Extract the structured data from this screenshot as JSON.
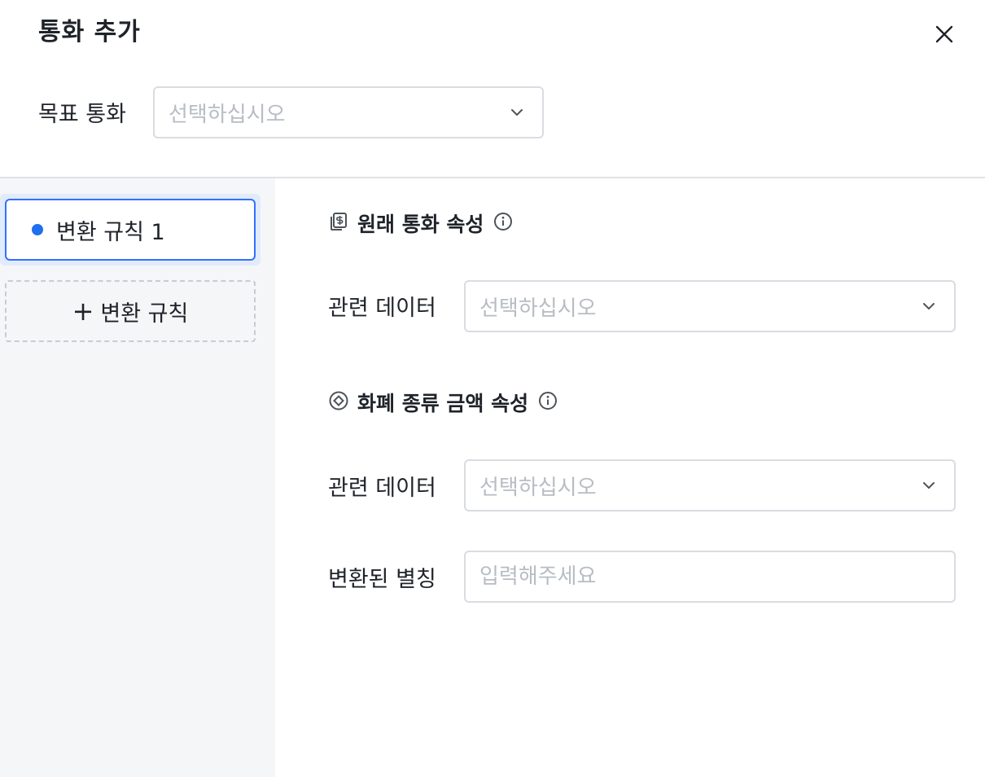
{
  "dialog": {
    "title": "통화 추가",
    "close_icon": "close-icon"
  },
  "target_currency": {
    "label": "목표 통화",
    "placeholder": "선택하십시오"
  },
  "sidebar": {
    "rules": [
      {
        "label": "변환 규칙 1",
        "active": true
      }
    ],
    "add_rule_label": "변환 규칙",
    "add_icon": "plus-icon"
  },
  "original_currency_section": {
    "title": "원래 통화 속성",
    "icon": "currency-icon",
    "info_icon": "info-icon",
    "field_label": "관련 데이터",
    "placeholder": "선택하십시오"
  },
  "denomination_section": {
    "title": "화폐 종류 금액 속성",
    "icon": "target-icon",
    "info_icon": "info-icon",
    "field_label": "관련 데이터",
    "placeholder": "선택하십시오",
    "alias_label": "변환된 별칭",
    "alias_placeholder": "입력해주세요"
  },
  "colors": {
    "accent": "#3370ff",
    "dot": "#1f6ff0",
    "sidebar_bg": "#f5f6f8",
    "placeholder": "#b8bcc3"
  }
}
